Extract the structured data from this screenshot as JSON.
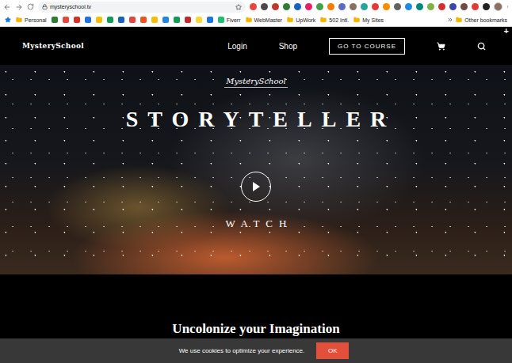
{
  "browser": {
    "url": "mysteryschool.tv",
    "extensions": [
      {
        "color": "#e8453c"
      },
      {
        "color": "#4a4a4a"
      },
      {
        "color": "#c0392b"
      },
      {
        "color": "#2e7d32"
      },
      {
        "color": "#1565c0"
      },
      {
        "color": "#e91e63"
      },
      {
        "color": "#43a047"
      },
      {
        "color": "#f57c00"
      },
      {
        "color": "#5c6bc0"
      },
      {
        "color": "#8d6e63"
      },
      {
        "color": "#26a69a"
      },
      {
        "color": "#e53935"
      },
      {
        "color": "#fb8c00"
      },
      {
        "color": "#616161"
      },
      {
        "color": "#1e88e5"
      },
      {
        "color": "#00897b"
      },
      {
        "color": "#7cb342"
      },
      {
        "color": "#d32f2f"
      },
      {
        "color": "#3949ab"
      },
      {
        "color": "#6d4c41"
      },
      {
        "color": "#e53935"
      },
      {
        "color": "#212121"
      }
    ],
    "bookmarks": [
      {
        "kind": "folder",
        "label": "Personal",
        "color": "#f5b400"
      },
      {
        "kind": "icon",
        "label": "",
        "color": "#2e7d32"
      },
      {
        "kind": "icon",
        "label": "",
        "color": "#e8453c"
      },
      {
        "kind": "icon",
        "label": "",
        "color": "#d93025"
      },
      {
        "kind": "icon",
        "label": "",
        "color": "#1a73e8"
      },
      {
        "kind": "icon",
        "label": "",
        "color": "#fbbc04"
      },
      {
        "kind": "icon",
        "label": "",
        "color": "#0f9d58"
      },
      {
        "kind": "icon",
        "label": "",
        "color": "#1565c0"
      },
      {
        "kind": "icon",
        "label": "",
        "color": "#e8453c"
      },
      {
        "kind": "icon",
        "label": "",
        "color": "#f4511e"
      },
      {
        "kind": "icon",
        "label": "",
        "color": "#fbbc04"
      },
      {
        "kind": "icon",
        "label": "",
        "color": "#1e88e5"
      },
      {
        "kind": "icon",
        "label": "",
        "color": "#0f9d58"
      },
      {
        "kind": "icon",
        "label": "",
        "color": "#c62828"
      },
      {
        "kind": "icon",
        "label": "",
        "color": "#fdd835"
      },
      {
        "kind": "icon",
        "label": "",
        "color": "#1a73e8"
      },
      {
        "kind": "site",
        "label": "Fiverr",
        "color": "#1dbf73"
      },
      {
        "kind": "folder",
        "label": "WebMaster",
        "color": "#f5b400"
      },
      {
        "kind": "folder",
        "label": "UpWork",
        "color": "#f5b400"
      },
      {
        "kind": "folder",
        "label": "502 Intl.",
        "color": "#f5b400"
      },
      {
        "kind": "folder",
        "label": "My Sites",
        "color": "#f5b400"
      }
    ],
    "other_bookmarks": "Other bookmarks"
  },
  "site": {
    "logo": "MysterySchool",
    "nav": [
      {
        "label": "Login"
      },
      {
        "label": "Shop"
      }
    ],
    "cta": "GO TO COURSE",
    "corner": "+"
  },
  "hero": {
    "logo": "MysterySchool",
    "title": "STORYTELLER",
    "action": "WATCH"
  },
  "section": {
    "heading": "Uncolonize your Imagination"
  },
  "cookie": {
    "message": "We use cookies to optimize your experience.",
    "button": "OK"
  }
}
